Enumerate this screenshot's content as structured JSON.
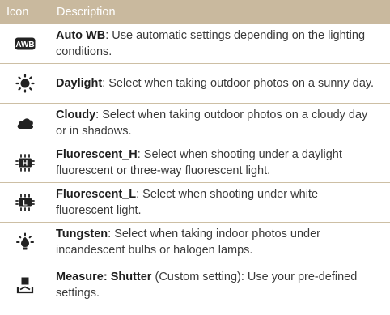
{
  "header": {
    "icon_col": "Icon",
    "desc_col": "Description"
  },
  "rows": [
    {
      "icon": "auto-wb-icon",
      "icon_label": "AWB",
      "term": "Auto WB",
      "sep": ": ",
      "text": "Use automatic settings depending on the lighting conditions."
    },
    {
      "icon": "daylight-icon",
      "term": "Daylight",
      "sep": ": ",
      "text": "Select when taking outdoor photos on a sunny day."
    },
    {
      "icon": "cloudy-icon",
      "term": "Cloudy",
      "sep": ": ",
      "text": "Select when taking outdoor photos on a cloudy day or in shadows."
    },
    {
      "icon": "fluorescent-h-icon",
      "icon_label": "H",
      "term": "Fluorescent_H",
      "sep": ": ",
      "text": "Select when shooting under a daylight fluorescent or three-way fluorescent light."
    },
    {
      "icon": "fluorescent-l-icon",
      "icon_label": "L",
      "term": "Fluorescent_L",
      "sep": ": ",
      "text": "Select when shooting under white fluorescent light."
    },
    {
      "icon": "tungsten-icon",
      "term": "Tungsten",
      "sep": ": ",
      "text": "Select when taking indoor photos under incandescent bulbs or halogen lamps."
    },
    {
      "icon": "measure-shutter-icon",
      "term": "Measure: Shutter",
      "sep": " ",
      "text": "(Custom setting): Use your pre-defined settings."
    }
  ],
  "colors": {
    "header_bg": "#c9b99e",
    "divider": "#cdbfa4",
    "icon": "#222222"
  }
}
